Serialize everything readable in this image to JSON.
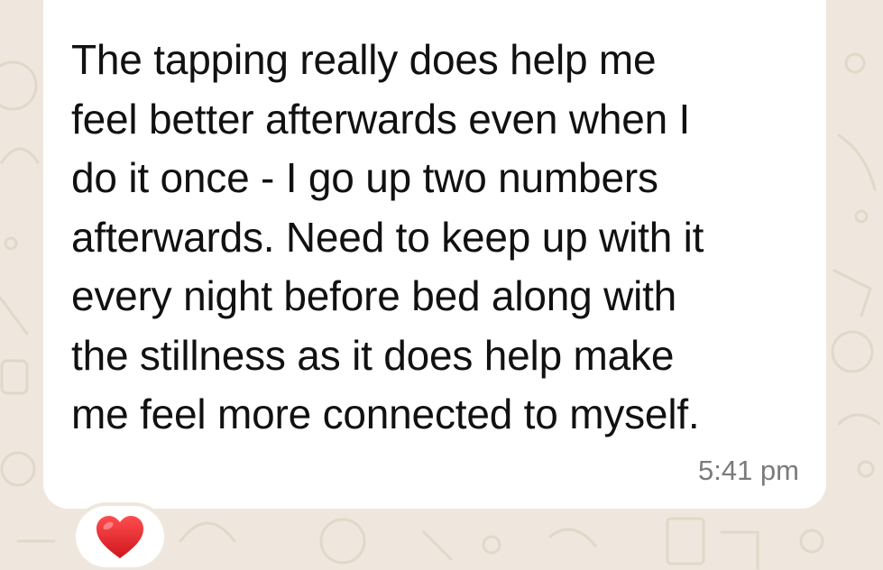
{
  "message": {
    "lines": [
      "The tapping really does help me",
      "feel better afterwards even when I",
      "do it once - I go up two numbers",
      "afterwards. Need to keep up with it",
      "every night before bed along with",
      "the stillness as it does help make",
      "me feel more connected to myself."
    ],
    "time": "5:41 pm"
  },
  "reaction": {
    "icon": "red-heart-icon"
  },
  "colors": {
    "background": "#efe7dd",
    "bubble": "#ffffff",
    "text": "#111111",
    "timestamp": "#7b7b7b",
    "heart": "#e0242b"
  }
}
